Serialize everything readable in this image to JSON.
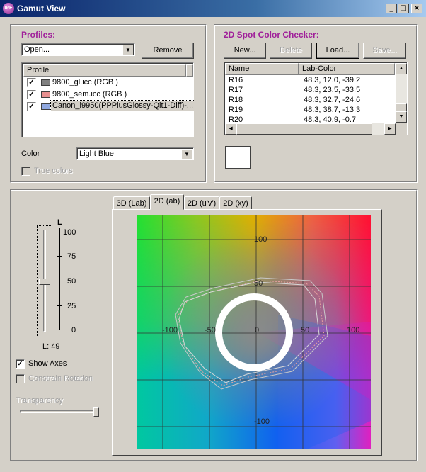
{
  "window": {
    "title": "Gamut View",
    "app_icon": "IPE",
    "minimize": "_",
    "maximize": "□",
    "close": "×"
  },
  "profiles": {
    "heading": "Profiles:",
    "dropdown_value": "Open...",
    "remove_label": "Remove",
    "column_header": "Profile",
    "items": [
      {
        "label": "9800_gl.icc (RGB )",
        "swatch": "#808080",
        "checked": true
      },
      {
        "label": "9800_sem.icc (RGB )",
        "swatch": "#e89090",
        "checked": true
      },
      {
        "label": "Canon_i9950(PPPlusGlossy-Qlt1-Diff)-...",
        "swatch": "#90a8e0",
        "checked": true
      }
    ],
    "color_label": "Color",
    "color_value": "Light Blue",
    "true_colors_label": "True colors"
  },
  "spot": {
    "heading": "2D Spot Color Checker:",
    "new_label": "New...",
    "delete_label": "Delete",
    "load_label": "Load...",
    "save_label": "Save...",
    "col_name": "Name",
    "col_lab": "Lab-Color",
    "rows": [
      {
        "name": "R16",
        "lab": "48.3, 12.0, -39.2"
      },
      {
        "name": "R17",
        "lab": "48.3, 23.5, -33.5"
      },
      {
        "name": "R18",
        "lab": "48.3, 32.7, -24.6"
      },
      {
        "name": "R19",
        "lab": "48.3, 38.7, -13.3"
      },
      {
        "name": "R20",
        "lab": "48.3, 40.9, -0.7"
      }
    ],
    "swatch_color": "#ffffff"
  },
  "view": {
    "tabs": [
      "3D (Lab)",
      "2D (ab)",
      "2D (u'v')",
      "2D (xy)"
    ],
    "active_tab": 1,
    "slider_axis_label": "L",
    "slider_ticks": [
      "100",
      "75",
      "50",
      "25",
      "0"
    ],
    "l_value": "L: 49",
    "l_level": 49,
    "show_axes_label": "Show Axes",
    "show_axes_checked": true,
    "constrain_rotation_label": "Constrain Rotation",
    "transparency_label": "Transparency",
    "transparency_level": 1.0,
    "plot_labels": {
      "y_pos": "100",
      "y_mid": "50",
      "x_neg": "-100",
      "x_mid_neg": "-50",
      "origin": "0",
      "x_mid_pos": "50",
      "x_pos": "100",
      "y_neg": "-100"
    }
  }
}
